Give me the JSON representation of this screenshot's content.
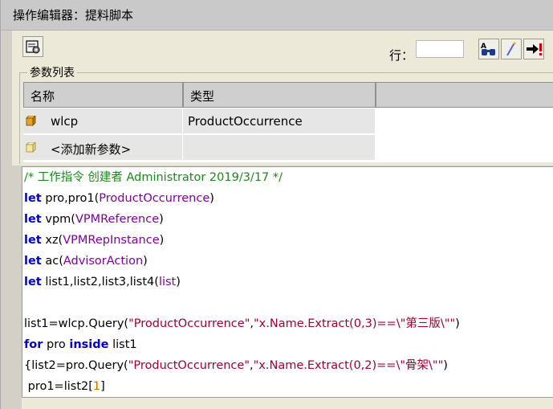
{
  "window": {
    "title": "操作编辑器：提料脚本"
  },
  "toolbar": {
    "row_label": "行：",
    "row_value": "",
    "icons": [
      "script-settings-icon",
      "find-icon",
      "magic-wand-icon",
      "run-arrow-icon"
    ]
  },
  "params": {
    "group_label": "参数列表",
    "col_name": "名称",
    "col_type": "类型",
    "col_extra": "",
    "rows": [
      {
        "name": "wlcp",
        "type": "ProductOccurrence"
      },
      {
        "name": "<添加新参数>",
        "type": ""
      }
    ]
  },
  "code": {
    "lines": [
      "/* 工作指令 创建者 Administrator 2019/3/17 */",
      "let pro,pro1(ProductOccurrence)",
      "let vpm(VPMReference)",
      "let xz(VPMRepInstance)",
      "let ac(AdvisorAction)",
      "let list1,list2,list3,list4(list)",
      "",
      "list1=wlcp.Query(\"ProductOccurrence\",\"x.Name.Extract(0,3)==\\\"第三版\\\"\")",
      "for pro inside list1",
      "{list2=pro.Query(\"ProductOccurrence\",\"x.Name.Extract(0,2)==\\\"骨架\\\"\")",
      " pro1=list2[1]"
    ]
  },
  "colors": {
    "keyword": "#0000c8",
    "type": "#8000a0",
    "string": "#a00030",
    "comment": "#1a8a1a",
    "number": "#c07000"
  }
}
